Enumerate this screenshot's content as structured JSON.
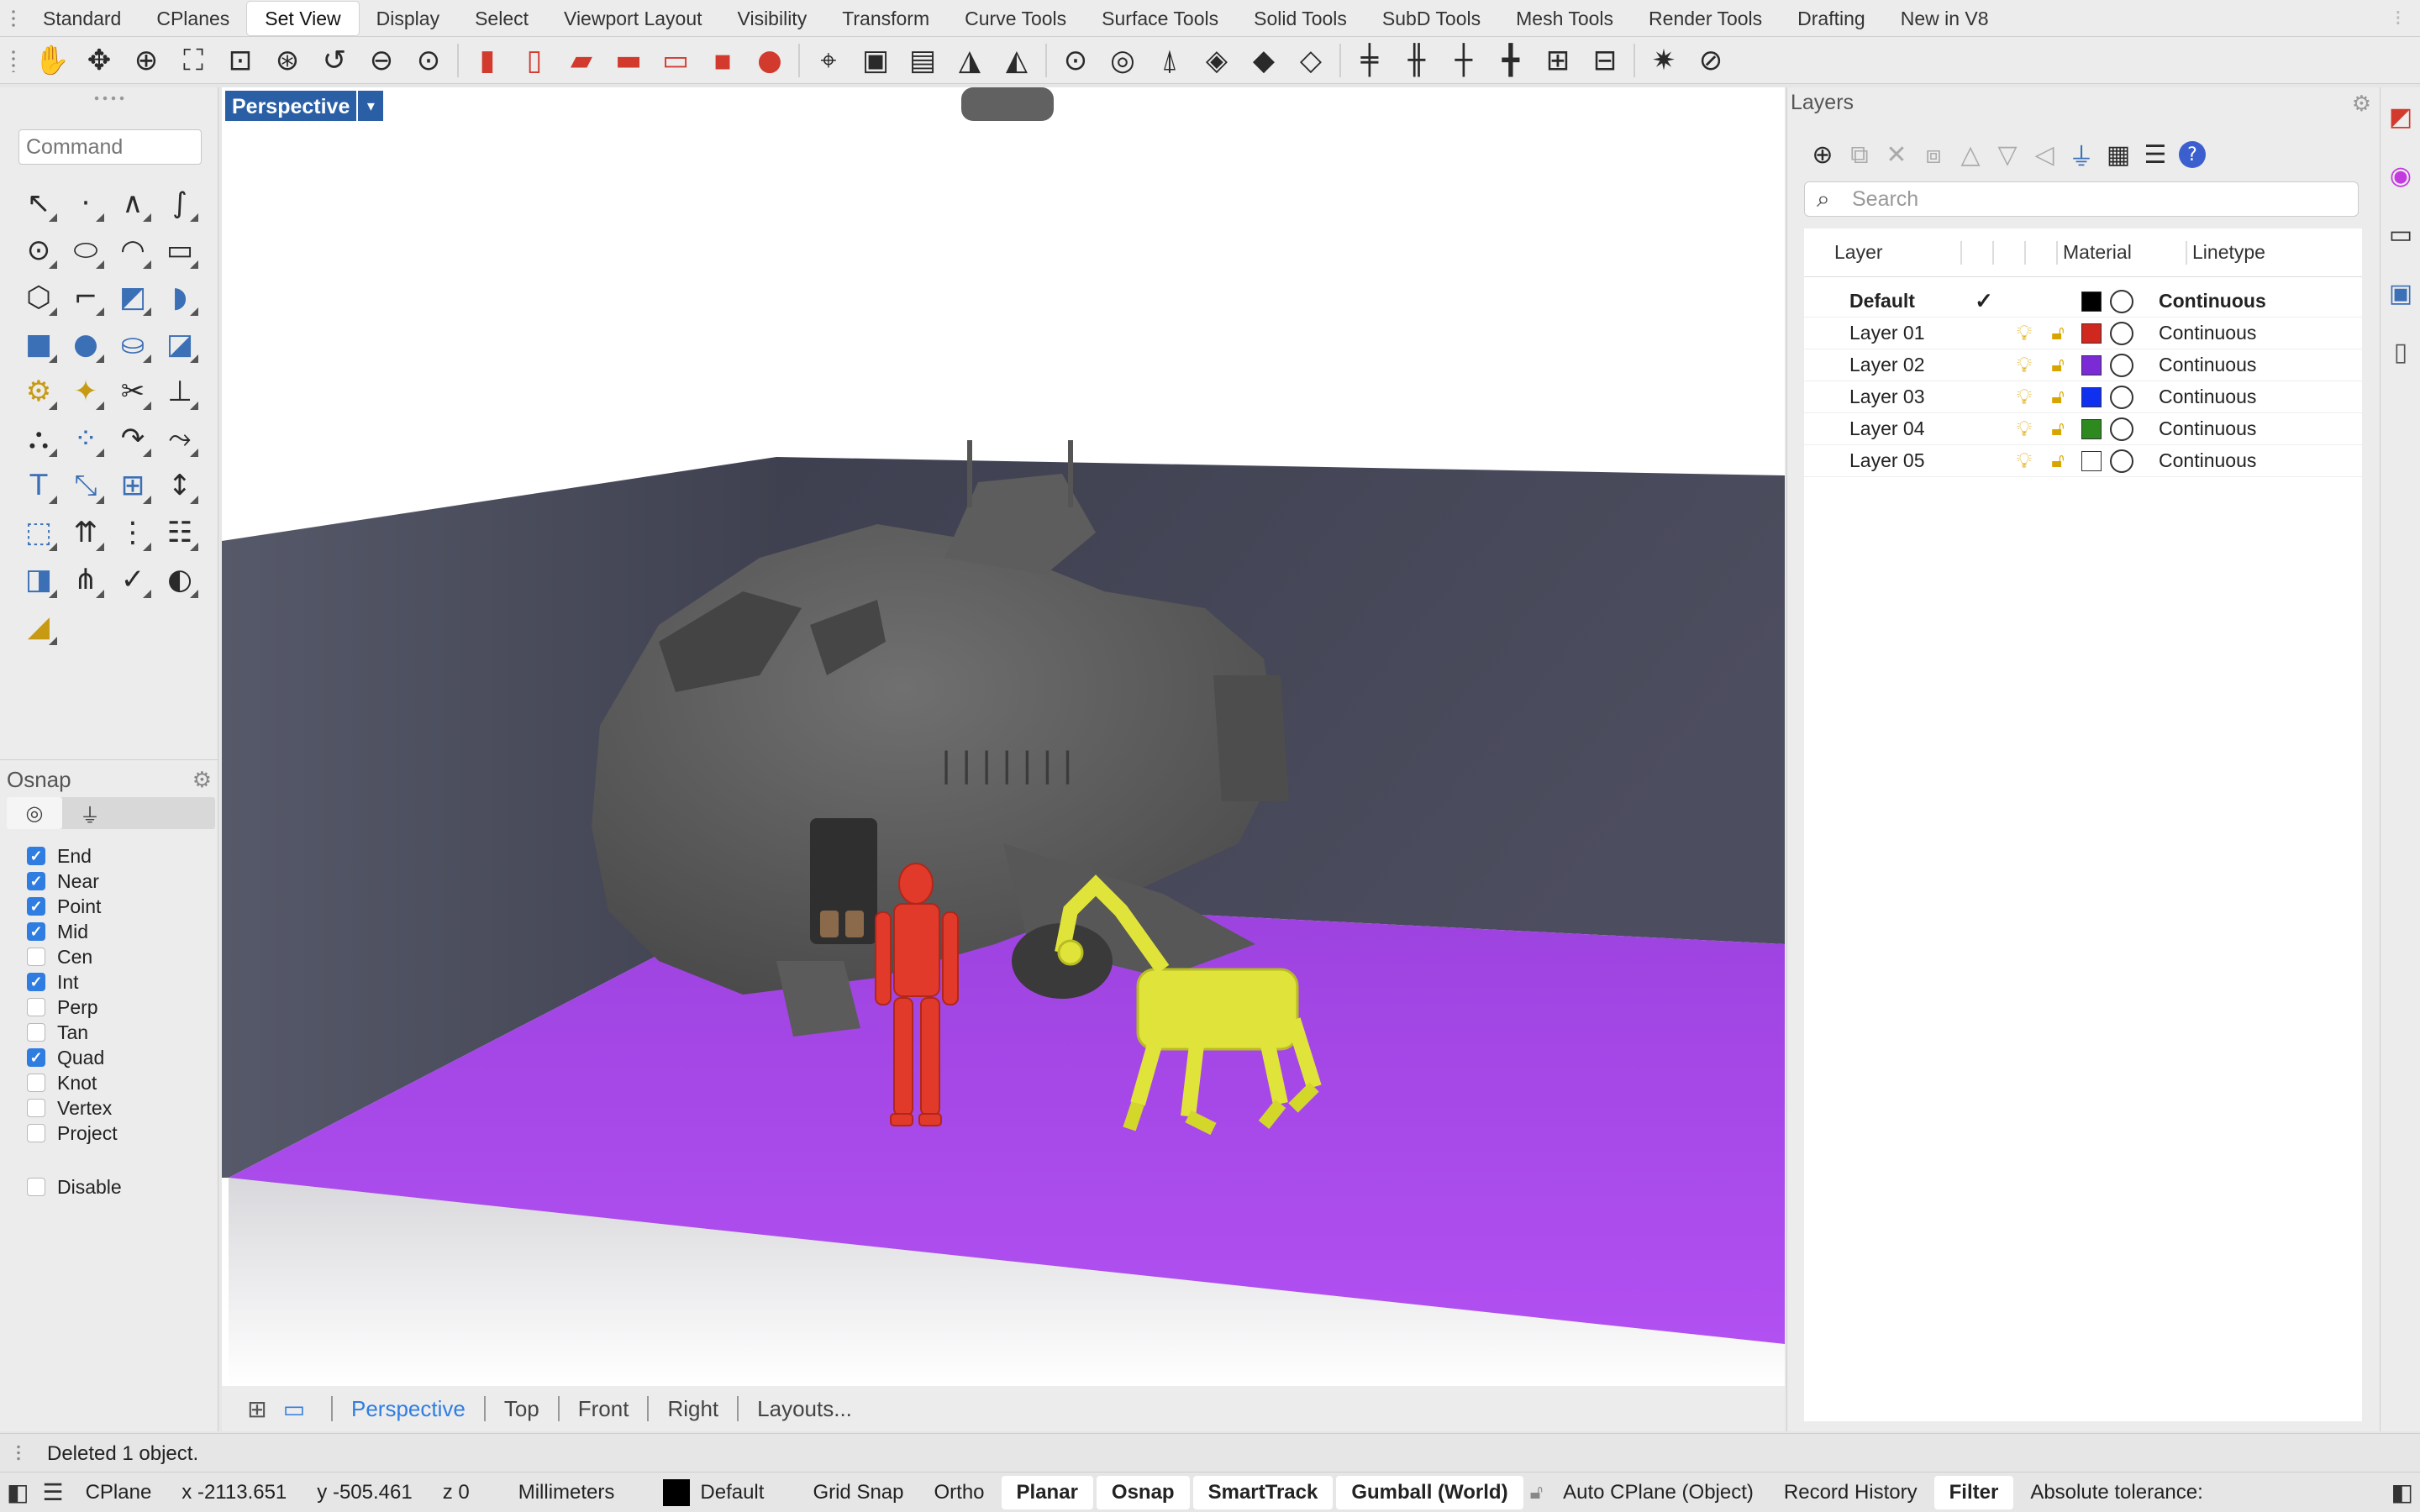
{
  "tabs": [
    "Standard",
    "CPlanes",
    "Set View",
    "Display",
    "Select",
    "Viewport Layout",
    "Visibility",
    "Transform",
    "Curve Tools",
    "Surface Tools",
    "Solid Tools",
    "SubD Tools",
    "Mesh Tools",
    "Render Tools",
    "Drafting",
    "New in V8"
  ],
  "active_tab": "Set View",
  "command": {
    "placeholder": "Command"
  },
  "osnap": {
    "title": "Osnap",
    "items": [
      {
        "label": "End",
        "checked": true
      },
      {
        "label": "Near",
        "checked": true
      },
      {
        "label": "Point",
        "checked": true
      },
      {
        "label": "Mid",
        "checked": true
      },
      {
        "label": "Cen",
        "checked": false
      },
      {
        "label": "Int",
        "checked": true
      },
      {
        "label": "Perp",
        "checked": false
      },
      {
        "label": "Tan",
        "checked": false
      },
      {
        "label": "Quad",
        "checked": true
      },
      {
        "label": "Knot",
        "checked": false
      },
      {
        "label": "Vertex",
        "checked": false
      },
      {
        "label": "Project",
        "checked": false
      }
    ],
    "disable_label": "Disable"
  },
  "viewport": {
    "label": "Perspective",
    "tabs": [
      "Perspective",
      "Top",
      "Front",
      "Right",
      "Layouts..."
    ],
    "active_tab": "Perspective"
  },
  "layers": {
    "title": "Layers",
    "search_placeholder": "Search",
    "columns": {
      "layer": "Layer",
      "material": "Material",
      "linetype": "Linetype"
    },
    "rows": [
      {
        "name": "Default",
        "current": true,
        "color": "#000000",
        "linetype": "Continuous"
      },
      {
        "name": "Layer 01",
        "current": false,
        "color": "#d0281e",
        "linetype": "Continuous"
      },
      {
        "name": "Layer 02",
        "current": false,
        "color": "#7a2bd6",
        "linetype": "Continuous"
      },
      {
        "name": "Layer 03",
        "current": false,
        "color": "#1030f0",
        "linetype": "Continuous"
      },
      {
        "name": "Layer 04",
        "current": false,
        "color": "#2e8a1e",
        "linetype": "Continuous"
      },
      {
        "name": "Layer 05",
        "current": false,
        "color": "#ffffff",
        "linetype": "Continuous"
      }
    ]
  },
  "history": {
    "text": "Deleted 1 object."
  },
  "status": {
    "cplane": "CPlane",
    "x": "x -2113.651",
    "y": "y -505.461",
    "z": "z 0",
    "units": "Millimeters",
    "layer": "Default",
    "grid_snap": "Grid Snap",
    "ortho": "Ortho",
    "planar": "Planar",
    "osnap": "Osnap",
    "smarttrack": "SmartTrack",
    "gumball": "Gumball (World)",
    "auto_cplane": "Auto CPlane (Object)",
    "record_history": "Record History",
    "filter": "Filter",
    "tolerance": "Absolute tolerance:"
  },
  "colors": {
    "floor": "#a648e8",
    "wall": "#4a4c5a",
    "robot": "#e23a2a",
    "dog": "#e0e43a",
    "ship": "#5a5a5a",
    "accent": "#2f7de1"
  }
}
